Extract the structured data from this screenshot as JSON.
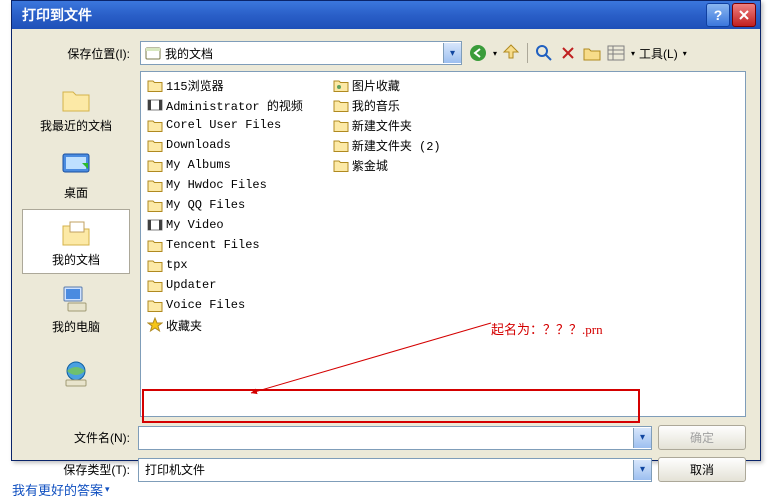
{
  "dialog": {
    "title": "打印到文件"
  },
  "toolbar": {
    "location_label": "保存位置(I):",
    "location_value": "我的文档",
    "tools_label": "工具(L)"
  },
  "places": [
    {
      "label": "我最近的文档",
      "icon": "recent"
    },
    {
      "label": "桌面",
      "icon": "desktop"
    },
    {
      "label": "我的文档",
      "icon": "mydocs",
      "selected": true
    },
    {
      "label": "我的电脑",
      "icon": "computer"
    },
    {
      "label": "",
      "icon": "network"
    }
  ],
  "files_col1": [
    {
      "name": "115浏览器",
      "icon": "folder"
    },
    {
      "name": "Administrator 的视频",
      "icon": "video"
    },
    {
      "name": "Corel User Files",
      "icon": "folder"
    },
    {
      "name": "Downloads",
      "icon": "folder"
    },
    {
      "name": "My Albums",
      "icon": "folder"
    },
    {
      "name": "My Hwdoc Files",
      "icon": "folder"
    },
    {
      "name": "My QQ Files",
      "icon": "folder"
    },
    {
      "name": "My Video",
      "icon": "video"
    },
    {
      "name": "Tencent Files",
      "icon": "folder"
    },
    {
      "name": "tpx",
      "icon": "folder"
    },
    {
      "name": "Updater",
      "icon": "folder"
    },
    {
      "name": "Voice Files",
      "icon": "folder"
    },
    {
      "name": "收藏夹",
      "icon": "star"
    }
  ],
  "files_col2": [
    {
      "name": "图片收藏",
      "icon": "pictures"
    },
    {
      "name": "我的音乐",
      "icon": "folder"
    },
    {
      "name": "新建文件夹",
      "icon": "folder"
    },
    {
      "name": "新建文件夹 (2)",
      "icon": "folder"
    },
    {
      "name": "紫金城",
      "icon": "folder"
    }
  ],
  "bottom": {
    "filename_label": "文件名(N):",
    "filename_value": "",
    "savetype_label": "保存类型(T):",
    "savetype_value": "打印机文件",
    "ok_label": "确定",
    "cancel_label": "取消"
  },
  "annotation": {
    "text": "起名为：？？？.prn"
  },
  "footer": {
    "link": "我有更好的答案"
  }
}
